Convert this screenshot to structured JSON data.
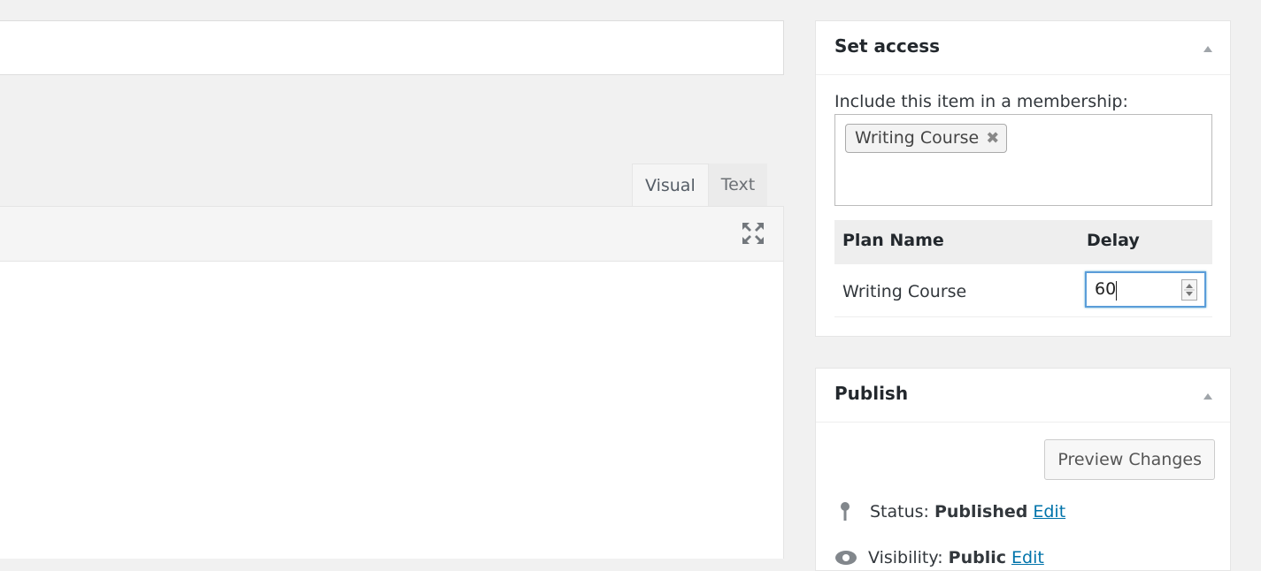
{
  "editor": {
    "tabs": [
      {
        "label": "Visual"
      },
      {
        "label": "Text"
      }
    ],
    "fullscreen_icon": "fullscreen-icon"
  },
  "set_access": {
    "title": "Set access",
    "include_label": "Include this item in a membership:",
    "selected_memberships": [
      "Writing Course"
    ],
    "remove_glyph": "✖",
    "table": {
      "headers": [
        "Plan Name",
        "Delay"
      ],
      "rows": [
        {
          "plan_name": "Writing Course",
          "delay": "60"
        }
      ]
    }
  },
  "publish": {
    "title": "Publish",
    "preview_button": "Preview Changes",
    "status_label": "Status:",
    "status_value": "Published",
    "status_edit": "Edit",
    "visibility_label": "Visibility:",
    "visibility_value": "Public",
    "visibility_edit": "Edit"
  },
  "colors": {
    "accent_link": "#0073aa",
    "focus_border": "#5b9dd9",
    "background": "#f1f1f1"
  }
}
